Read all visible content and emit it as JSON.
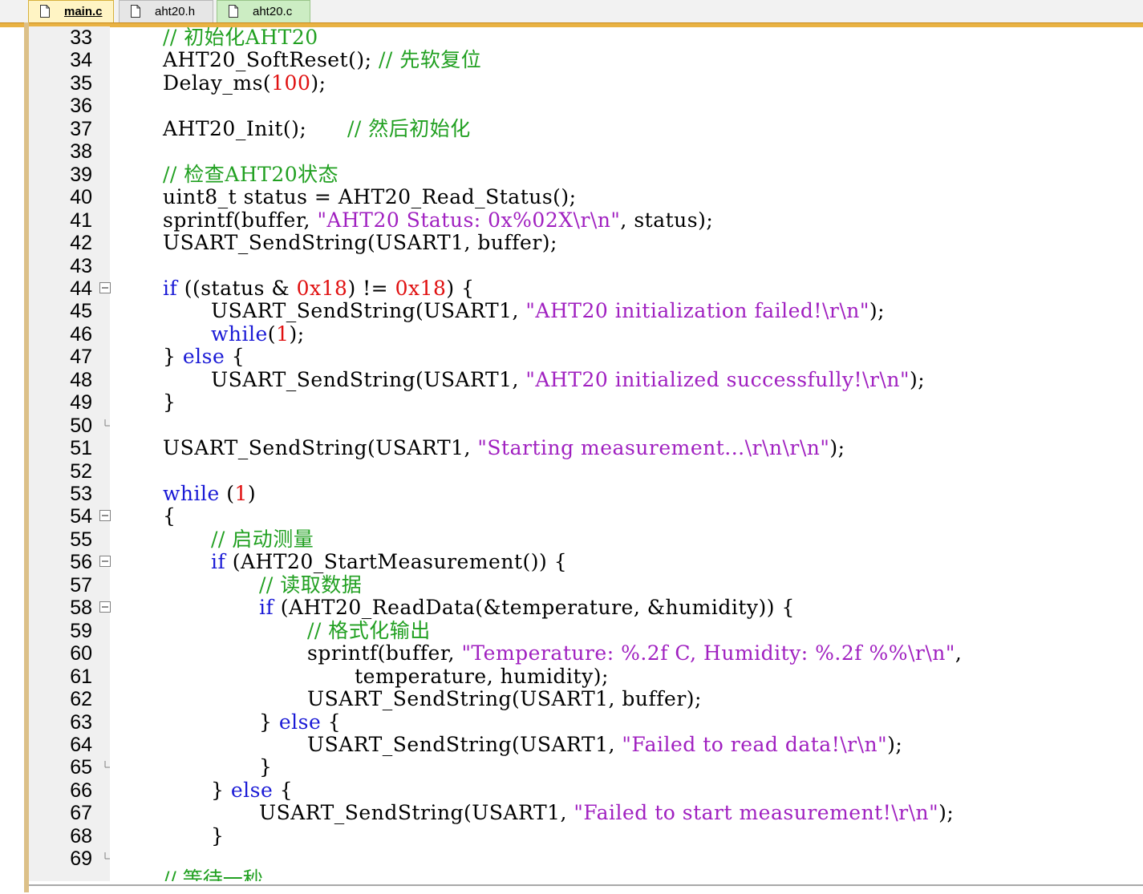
{
  "tabs": [
    {
      "label": "main.c",
      "active": true
    },
    {
      "label": "aht20.h",
      "active": false
    },
    {
      "label": "aht20.c",
      "active": false
    }
  ],
  "colors": {
    "keyword": "#1a1ad6",
    "comment": "#21a021",
    "string": "#a020c0",
    "number": "#e01010",
    "active_tab": "#fff4c4",
    "frame": "#e9b243"
  },
  "code": {
    "lines": [
      {
        "n": "33",
        "indent": 0,
        "fold": "",
        "tokens": [
          [
            "comment",
            "// 初始化AHT20"
          ]
        ]
      },
      {
        "n": "34",
        "indent": 0,
        "fold": "",
        "tokens": [
          [
            "plain",
            "AHT20_SoftReset(); "
          ],
          [
            "comment",
            "// 先软复位"
          ]
        ]
      },
      {
        "n": "35",
        "indent": 0,
        "fold": "",
        "tokens": [
          [
            "plain",
            "Delay_ms("
          ],
          [
            "number",
            "100"
          ],
          [
            "plain",
            ");"
          ]
        ]
      },
      {
        "n": "36",
        "indent": 0,
        "fold": "",
        "tokens": []
      },
      {
        "n": "37",
        "indent": 0,
        "fold": "",
        "tokens": [
          [
            "plain",
            "AHT20_Init();      "
          ],
          [
            "comment",
            "// 然后初始化"
          ]
        ]
      },
      {
        "n": "38",
        "indent": 0,
        "fold": "",
        "tokens": []
      },
      {
        "n": "39",
        "indent": 0,
        "fold": "",
        "tokens": [
          [
            "comment",
            "// 检查AHT20状态"
          ]
        ]
      },
      {
        "n": "40",
        "indent": 0,
        "fold": "",
        "tokens": [
          [
            "plain",
            "uint8_t status = AHT20_Read_Status();"
          ]
        ]
      },
      {
        "n": "41",
        "indent": 0,
        "fold": "",
        "tokens": [
          [
            "plain",
            "sprintf(buffer, "
          ],
          [
            "string",
            "\"AHT20 Status: 0x%02X\\r\\n\""
          ],
          [
            "plain",
            ", status);"
          ]
        ]
      },
      {
        "n": "42",
        "indent": 0,
        "fold": "",
        "tokens": [
          [
            "plain",
            "USART_SendString(USART1, buffer);"
          ]
        ]
      },
      {
        "n": "43",
        "indent": 0,
        "fold": "",
        "tokens": []
      },
      {
        "n": "44",
        "indent": 0,
        "fold": "box",
        "tokens": [
          [
            "keyword",
            "if"
          ],
          [
            "plain",
            " ((status & "
          ],
          [
            "number",
            "0x18"
          ],
          [
            "plain",
            ") != "
          ],
          [
            "number",
            "0x18"
          ],
          [
            "plain",
            ") {"
          ]
        ]
      },
      {
        "n": "45",
        "indent": 1,
        "fold": "",
        "tokens": [
          [
            "plain",
            "USART_SendString(USART1, "
          ],
          [
            "string",
            "\"AHT20 initialization failed!\\r\\n\""
          ],
          [
            "plain",
            ");"
          ]
        ]
      },
      {
        "n": "46",
        "indent": 1,
        "fold": "",
        "tokens": [
          [
            "keyword",
            "while"
          ],
          [
            "plain",
            "("
          ],
          [
            "number",
            "1"
          ],
          [
            "plain",
            ");"
          ]
        ]
      },
      {
        "n": "47",
        "indent": 0,
        "fold": "",
        "tokens": [
          [
            "plain",
            "} "
          ],
          [
            "keyword",
            "else"
          ],
          [
            "plain",
            " {"
          ]
        ]
      },
      {
        "n": "48",
        "indent": 1,
        "fold": "",
        "tokens": [
          [
            "plain",
            "USART_SendString(USART1, "
          ],
          [
            "string",
            "\"AHT20 initialized successfully!\\r\\n\""
          ],
          [
            "plain",
            ");"
          ]
        ]
      },
      {
        "n": "49",
        "indent": 0,
        "fold": "",
        "tokens": [
          [
            "plain",
            "}"
          ]
        ]
      },
      {
        "n": "50",
        "indent": 0,
        "fold": "end",
        "tokens": []
      },
      {
        "n": "51",
        "indent": 0,
        "fold": "",
        "tokens": [
          [
            "plain",
            "USART_SendString(USART1, "
          ],
          [
            "string",
            "\"Starting measurement...\\r\\n\\r\\n\""
          ],
          [
            "plain",
            ");"
          ]
        ]
      },
      {
        "n": "52",
        "indent": 0,
        "fold": "",
        "tokens": []
      },
      {
        "n": "53",
        "indent": 0,
        "fold": "",
        "tokens": [
          [
            "keyword",
            "while"
          ],
          [
            "plain",
            " ("
          ],
          [
            "number",
            "1"
          ],
          [
            "plain",
            ")"
          ]
        ]
      },
      {
        "n": "54",
        "indent": 0,
        "fold": "box",
        "tokens": [
          [
            "plain",
            "{"
          ]
        ]
      },
      {
        "n": "55",
        "indent": 1,
        "fold": "",
        "tokens": [
          [
            "comment",
            "// 启动测量"
          ]
        ]
      },
      {
        "n": "56",
        "indent": 1,
        "fold": "box",
        "tokens": [
          [
            "keyword",
            "if"
          ],
          [
            "plain",
            " (AHT20_StartMeasurement()) {"
          ]
        ]
      },
      {
        "n": "57",
        "indent": 2,
        "fold": "",
        "tokens": [
          [
            "comment",
            "// 读取数据"
          ]
        ]
      },
      {
        "n": "58",
        "indent": 2,
        "fold": "box",
        "tokens": [
          [
            "keyword",
            "if"
          ],
          [
            "plain",
            " (AHT20_ReadData(&temperature, &humidity)) {"
          ]
        ]
      },
      {
        "n": "59",
        "indent": 3,
        "fold": "",
        "tokens": [
          [
            "comment",
            "// 格式化输出"
          ]
        ]
      },
      {
        "n": "60",
        "indent": 3,
        "fold": "",
        "tokens": [
          [
            "plain",
            "sprintf(buffer, "
          ],
          [
            "string",
            "\"Temperature: %.2f C, Humidity: %.2f %%\\r\\n\""
          ],
          [
            "plain",
            ","
          ]
        ]
      },
      {
        "n": "61",
        "indent": 3,
        "fold": "",
        "tokens": [
          [
            "plain",
            "       temperature, humidity);"
          ]
        ]
      },
      {
        "n": "62",
        "indent": 3,
        "fold": "",
        "tokens": [
          [
            "plain",
            "USART_SendString(USART1, buffer);"
          ]
        ]
      },
      {
        "n": "63",
        "indent": 2,
        "fold": "",
        "tokens": [
          [
            "plain",
            "} "
          ],
          [
            "keyword",
            "else"
          ],
          [
            "plain",
            " {"
          ]
        ]
      },
      {
        "n": "64",
        "indent": 3,
        "fold": "",
        "tokens": [
          [
            "plain",
            "USART_SendString(USART1, "
          ],
          [
            "string",
            "\"Failed to read data!\\r\\n\""
          ],
          [
            "plain",
            ");"
          ]
        ]
      },
      {
        "n": "65",
        "indent": 2,
        "fold": "end",
        "tokens": [
          [
            "plain",
            "}"
          ]
        ]
      },
      {
        "n": "66",
        "indent": 1,
        "fold": "",
        "tokens": [
          [
            "plain",
            "} "
          ],
          [
            "keyword",
            "else"
          ],
          [
            "plain",
            " {"
          ]
        ]
      },
      {
        "n": "67",
        "indent": 2,
        "fold": "",
        "tokens": [
          [
            "plain",
            "USART_SendString(USART1, "
          ],
          [
            "string",
            "\"Failed to start measurement!\\r\\n\""
          ],
          [
            "plain",
            ");"
          ]
        ]
      },
      {
        "n": "68",
        "indent": 1,
        "fold": "",
        "tokens": [
          [
            "plain",
            "}"
          ]
        ]
      },
      {
        "n": "69",
        "indent": 0,
        "fold": "end",
        "tokens": []
      }
    ]
  }
}
